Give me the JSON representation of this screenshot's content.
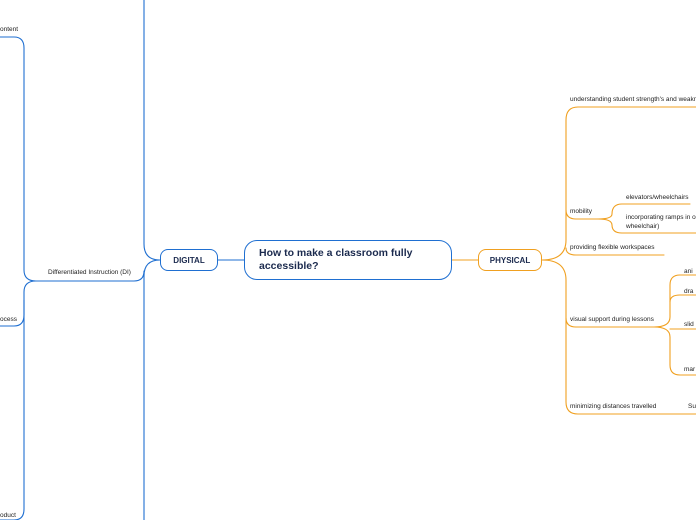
{
  "central": {
    "title": "How to make a classroom fully accessible?"
  },
  "colors": {
    "digital": "#1f6fd1",
    "physical": "#f0a020"
  },
  "digital": {
    "label": "DIGITAL",
    "di_label": "Differentiated Instruction (DI)",
    "content_label": "ontent",
    "process_label": "ocess",
    "product_label": "oduct"
  },
  "physical": {
    "label": "PHYSICAL",
    "strengths": "understanding student strength's and weakn",
    "mobility": "mobility",
    "elevators": "elevators/wheelchairs",
    "ramps": "incorporating ramps in or wheelchair)",
    "workspaces": "providing flexible workspaces",
    "visual": "visual support during lessons",
    "visual_a": "ani",
    "visual_b": "dra",
    "visual_c": "slid",
    "visual_d": "mar",
    "distances": "minimizing distances travelled",
    "distances_a": "Su"
  }
}
